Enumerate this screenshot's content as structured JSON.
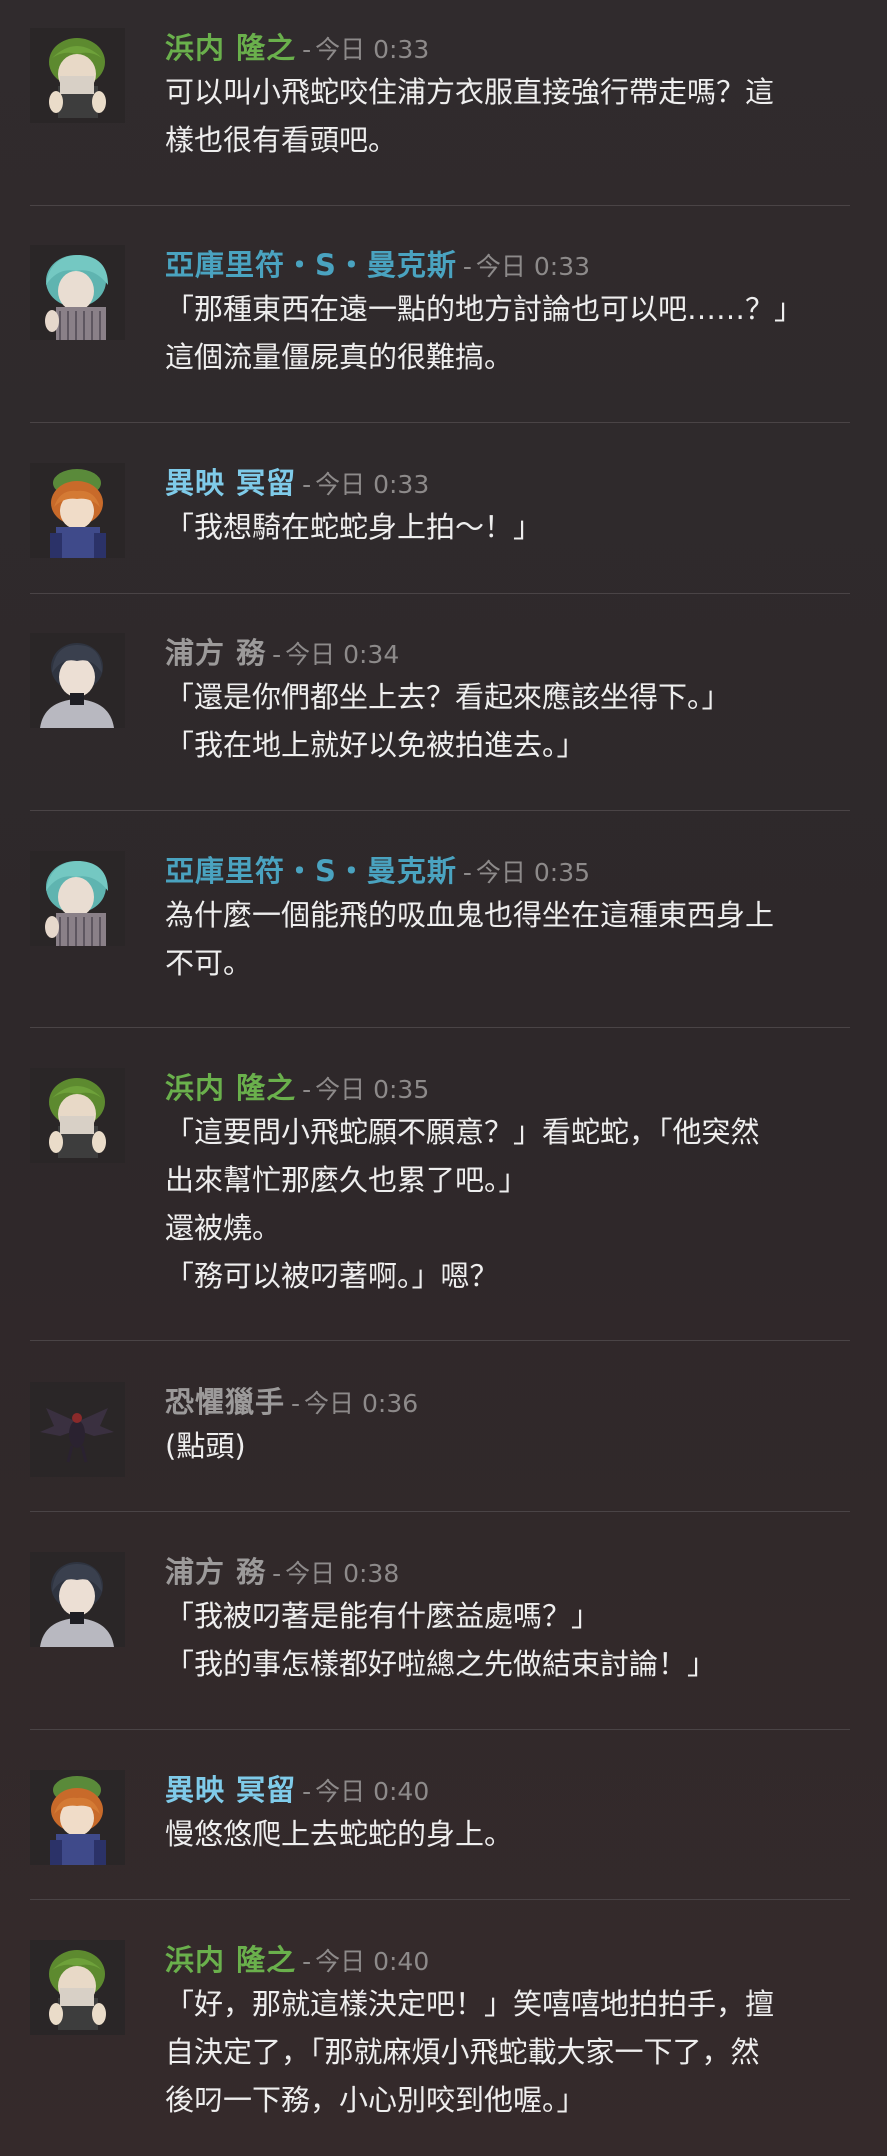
{
  "colors": {
    "green": "#6ab04c",
    "cyan": "#4aa3c0",
    "lightblue": "#7fcbe9",
    "gray": "#9c9a9a",
    "timestamp": "#8d8a8a",
    "text": "#eeeeee"
  },
  "separator": "-",
  "messages": [
    {
      "author": "浜内 隆之",
      "author_color": "green",
      "avatar_icon": "green-haired-character-avatar-icon",
      "timestamp": "今日 0:33",
      "lines": [
        "可以叫小飛蛇咬住浦方衣服直接強行帶走嗎？這",
        "樣也很有看頭吧。"
      ]
    },
    {
      "author": "亞庫里符・S・曼克斯",
      "author_color": "cyan",
      "avatar_icon": "teal-haired-character-avatar-icon",
      "timestamp": "今日 0:33",
      "lines": [
        "「那種東西在遠一點的地方討論也可以吧……？」",
        "這個流量僵屍真的很難搞。"
      ]
    },
    {
      "author": "異映 冥留",
      "author_color": "lightblue",
      "avatar_icon": "pumpkin-hat-character-avatar-icon",
      "timestamp": "今日 0:33",
      "lines": [
        "「我想騎在蛇蛇身上拍～！」"
      ]
    },
    {
      "author": "浦方 務",
      "author_color": "gray",
      "avatar_icon": "dark-haired-character-avatar-icon",
      "timestamp": "今日 0:34",
      "lines": [
        "「還是你們都坐上去？看起來應該坐得下。」",
        "「我在地上就好以免被拍進去。」"
      ]
    },
    {
      "author": "亞庫里符・S・曼克斯",
      "author_color": "cyan",
      "avatar_icon": "teal-haired-character-avatar-icon",
      "timestamp": "今日 0:35",
      "lines": [
        "為什麼一個能飛的吸血鬼也得坐在這種東西身上",
        "不可。"
      ]
    },
    {
      "author": "浜内 隆之",
      "author_color": "green",
      "avatar_icon": "green-haired-character-avatar-icon",
      "timestamp": "今日 0:35",
      "lines": [
        "「這要問小飛蛇願不願意？」看蛇蛇，「他突然",
        "出來幫忙那麼久也累了吧。」",
        "還被燒。",
        "「務可以被叼著啊。」嗯？"
      ]
    },
    {
      "author": "恐懼獵手",
      "author_color": "gray",
      "avatar_icon": "winged-creature-avatar-icon",
      "timestamp": "今日 0:36",
      "lines": [
        "(點頭)"
      ]
    },
    {
      "author": "浦方 務",
      "author_color": "gray",
      "avatar_icon": "dark-haired-character-avatar-icon",
      "timestamp": "今日 0:38",
      "lines": [
        "「我被叼著是能有什麼益處嗎？」",
        "「我的事怎樣都好啦總之先做結束討論！」"
      ]
    },
    {
      "author": "異映 冥留",
      "author_color": "lightblue",
      "avatar_icon": "pumpkin-hat-character-avatar-icon",
      "timestamp": "今日 0:40",
      "lines": [
        "慢悠悠爬上去蛇蛇的身上。"
      ]
    },
    {
      "author": "浜内 隆之",
      "author_color": "green",
      "avatar_icon": "green-haired-character-avatar-icon",
      "timestamp": "今日 0:40",
      "lines": [
        "「好，那就這樣決定吧！」笑嘻嘻地拍拍手，擅",
        "自決定了，「那就麻煩小飛蛇載大家一下了，然",
        "後叼一下務，小心別咬到他喔。」"
      ]
    }
  ]
}
